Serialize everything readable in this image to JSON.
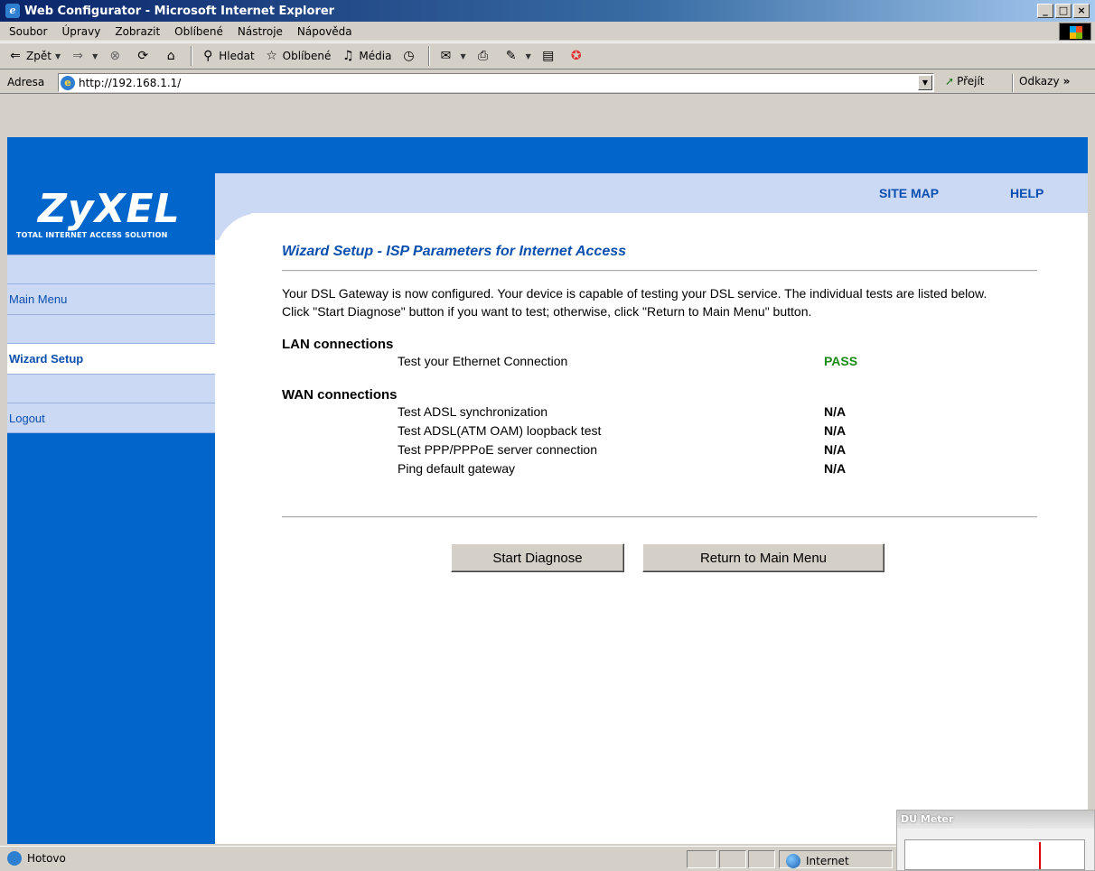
{
  "window": {
    "title": "Web Configurator - Microsoft Internet Explorer"
  },
  "menubar": {
    "items": [
      "Soubor",
      "Úpravy",
      "Zobrazit",
      "Oblíbené",
      "Nástroje",
      "Nápověda"
    ]
  },
  "toolbar": {
    "back": "Zpět",
    "search": "Hledat",
    "favorites": "Oblíbené",
    "media": "Média"
  },
  "address": {
    "label": "Adresa",
    "url": "http://192.168.1.1/",
    "go": "Přejít",
    "links": "Odkazy"
  },
  "logo": {
    "brand": "ZyXEL",
    "tagline": "TOTAL INTERNET ACCESS SOLUTION"
  },
  "header": {
    "site_map": "SITE MAP",
    "help": "HELP"
  },
  "nav": {
    "main_menu": "Main Menu",
    "wizard_setup": "Wizard Setup",
    "logout": "Logout"
  },
  "content": {
    "title": "Wizard Setup - ISP Parameters for Internet Access",
    "intro": "Your DSL Gateway is now configured. Your device is capable of testing your DSL service. The individual tests are listed below. Click \"Start Diagnose\" button if you want to test; otherwise, click \"Return to Main Menu\" button.",
    "lan": {
      "title": "LAN connections",
      "tests": [
        {
          "label": "Test your Ethernet Connection",
          "result": "PASS"
        }
      ]
    },
    "wan": {
      "title": "WAN connections",
      "tests": [
        {
          "label": "Test ADSL synchronization",
          "result": "N/A"
        },
        {
          "label": "Test ADSL(ATM OAM) loopback test",
          "result": "N/A"
        },
        {
          "label": "Test PPP/PPPoE server connection",
          "result": "N/A"
        },
        {
          "label": "Ping default gateway",
          "result": "N/A"
        }
      ]
    },
    "buttons": {
      "start": "Start Diagnose",
      "return": "Return to Main Menu"
    }
  },
  "status": {
    "left": "Hotovo",
    "zone": "Internet"
  },
  "du_meter": {
    "title": "DU Meter"
  },
  "colors": {
    "brand_blue": "#0066cc",
    "light_blue": "#ccd9f5",
    "pass_green": "#1a8a1a"
  }
}
